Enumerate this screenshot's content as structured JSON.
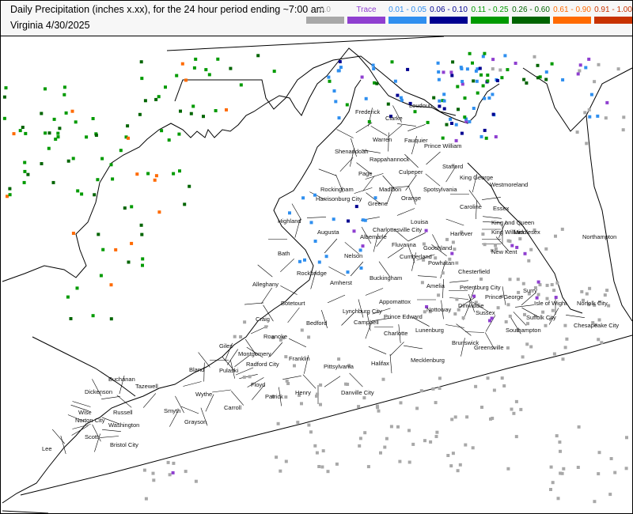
{
  "header": {
    "title": "Daily Precipitation (inches  x.xx),  for the 24 hour period ending ~7:00 am",
    "subtitle": "Virginia 4/30/2025"
  },
  "legend": [
    {
      "label": "0.0",
      "color": "#a8a8a8",
      "text_color": "#a8a8a8"
    },
    {
      "label": "Trace",
      "color": "#8f3fd0",
      "text_color": "#8f3fd0"
    },
    {
      "label": "0.01 - 0.05",
      "color": "#2f8fef",
      "text_color": "#2f8fef"
    },
    {
      "label": "0.06 - 0.10",
      "color": "#000090",
      "text_color": "#000090"
    },
    {
      "label": "0.11 - 0.25",
      "color": "#009a00",
      "text_color": "#009a00"
    },
    {
      "label": "0.26 - 0.60",
      "color": "#006400",
      "text_color": "#006400"
    },
    {
      "label": "0.61 - 0.90",
      "color": "#ff6a00",
      "text_color": "#ff6a00"
    },
    {
      "label": "0.91 - 1.00",
      "color": "#c83200",
      "text_color": "#c83200"
    }
  ],
  "map": {
    "county_labels": [
      "Frederick",
      "Clarke",
      "Loudoun",
      "Warren",
      "Fauquier",
      "Prince William",
      "Shenandoah",
      "Rappahannock",
      "Page",
      "Culpeper",
      "Stafford",
      "King George",
      "Westmoreland",
      "Rockingham",
      "Harrisonburg City",
      "Madison",
      "Spotsylvania",
      "Greene",
      "Orange",
      "Caroline",
      "Essex",
      "Highland",
      "Augusta",
      "Charlottesville City",
      "Albemarle",
      "Louisa",
      "Hanover",
      "King and Queen",
      "King William",
      "Middlesex",
      "Northampton",
      "Fluvanna",
      "Goochland",
      "New Kent",
      "Bath",
      "Nelson",
      "Powhatan",
      "Chesterfield",
      "Cumberland",
      "Buckingham",
      "Amelia",
      "Petersburg City",
      "Prince George",
      "Surry",
      "Isle of Wight",
      "Norfolk City",
      "Alleghany",
      "Rockbridge",
      "Amherst",
      "Appomattox",
      "Lynchburg City",
      "Nottoway",
      "Dinwiddie",
      "Sussex",
      "Suffolk City",
      "Chesapeake City",
      "Botetourt",
      "Craig",
      "Bedford",
      "Campbell",
      "Prince Edward",
      "Lunenburg",
      "Southampton",
      "Charlotte",
      "Brunswick",
      "Greensville",
      "Roanoke",
      "Giles",
      "Montgomery",
      "Radford City",
      "Pulaski",
      "Bland",
      "Franklin",
      "Pittsylvania",
      "Halifax",
      "Mecklenburg",
      "Buchanan",
      "Tazewell",
      "Wythe",
      "Floyd",
      "Patrick",
      "Henry",
      "Danville City",
      "Dickenson",
      "Russell",
      "Smyth",
      "Carroll",
      "Wise",
      "Norton City",
      "Washington",
      "Grayson",
      "Scott",
      "Bristol City",
      "Lee"
    ]
  }
}
